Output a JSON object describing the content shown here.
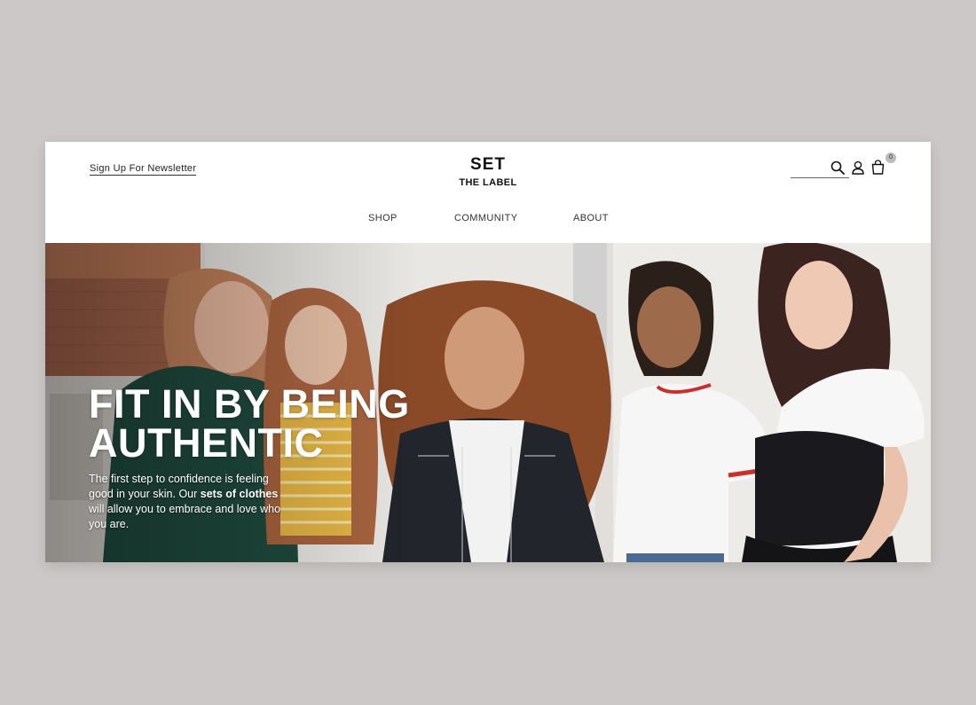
{
  "header": {
    "newsletter_link": "Sign Up For Newsletter",
    "logo_line1": "SET",
    "logo_line2": "THE LABEL",
    "cart_count": "0",
    "icons": [
      "search-icon",
      "account-icon",
      "cart-icon"
    ]
  },
  "nav": {
    "items": [
      {
        "label": "SHOP"
      },
      {
        "label": "COMMUNITY"
      },
      {
        "label": "ABOUT"
      }
    ]
  },
  "hero": {
    "title_line1": "FIT IN BY BEING",
    "title_line2": "AUTHENTIC",
    "copy_part1": "The first step to confidence is feeling good in your skin. Our ",
    "copy_bold": "sets of clothes",
    "copy_part2": " will allow you to embrace and love who you are."
  },
  "colors": {
    "page_background": "#cbc8c7",
    "header_background": "#ffffff",
    "text_dark": "#222222",
    "hero_text": "#ffffff"
  }
}
